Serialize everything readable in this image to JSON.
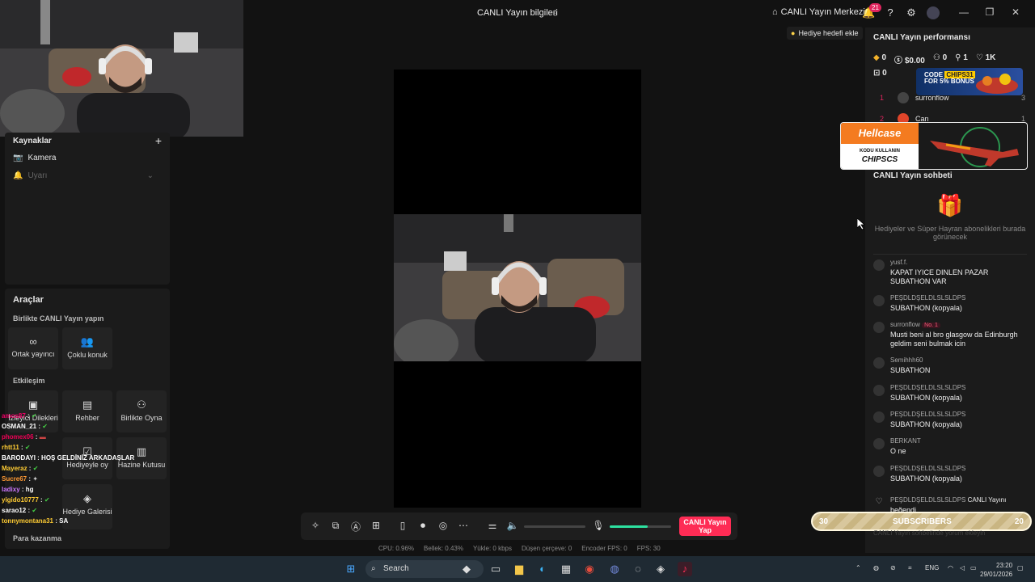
{
  "topbar": {
    "title": "CANLI Yayın bilgileri",
    "live_center": "CANLI Yayın Merkezi",
    "notification_count": "21"
  },
  "sources": {
    "heading": "Kaynaklar",
    "items": [
      "Kamera",
      "Uyarı"
    ]
  },
  "tools": {
    "heading": "Araçlar",
    "collab_heading": "Birlikte CANLI Yayın yapın",
    "collab": [
      "Ortak yayıncı",
      "Çoklu konuk"
    ],
    "interaction_heading": "Etkileşim",
    "interaction": [
      "İzleyici Dilekleri",
      "Rehber",
      "Birlikte Oyna",
      "Hediyeyle oy",
      "Hazine Kutusu",
      "Hediye Galerisi"
    ],
    "earn_heading": "Para kazanma"
  },
  "overlay_chat": [
    {
      "user": "amos87",
      "msg": ""
    },
    {
      "user": "OSMAN_21",
      "msg": ""
    },
    {
      "user": "phomex06",
      "msg": ""
    },
    {
      "user": "rhtt11",
      "msg": ""
    },
    {
      "user": "BARODAYI",
      "msg": "HOŞ GELDİNİZ ARKADAŞLAR"
    },
    {
      "user": "Mayeraz",
      "msg": ""
    },
    {
      "user": "Sucre67",
      "msg": ""
    },
    {
      "user": "ladixy",
      "msg": "hg"
    },
    {
      "user": "yigido10777",
      "msg": ""
    },
    {
      "user": "sarao12",
      "msg": ""
    },
    {
      "user": "tonnymontana31",
      "msg": "SA"
    }
  ],
  "controls": {
    "go_live": "CANLI Yayın Yap",
    "volume_level": 0,
    "mic_level": 0.62
  },
  "stats": {
    "cpu": "CPU: 0.96%",
    "memory": "Bellek: 0.43%",
    "upload": "Yükle: 0 kbps",
    "dropped": "Düşen çerçeve: 0",
    "encoder": "Encoder FPS: 0",
    "fps": "FPS: 30"
  },
  "goal_button": "Hediye hedefi ekle",
  "performance": {
    "title": "CANLI Yayın performansı",
    "diamonds": "0",
    "earnings": "$0.00",
    "viewers": "0",
    "followers": "1",
    "likes": "1K",
    "gifts": "0"
  },
  "ranking": [
    {
      "rank": "1",
      "user": "surronflow",
      "count": "3"
    },
    {
      "rank": "2",
      "user": "Can",
      "count": "1"
    }
  ],
  "live_chat": {
    "title": "CANLI Yayın sohbeti",
    "empty_gifts": "Hediyeler ve Süper Hayran abonelikleri burada görünecek",
    "messages": [
      {
        "user": "yusf.f.",
        "text": "KAPAT IYICE DINLEN PAZAR SUBATHON VAR"
      },
      {
        "user": "PEŞDLDŞELDLSLSLDPS",
        "text": "SUBATHON (kopyala)"
      },
      {
        "user": "surronflow",
        "badge": "No. 1",
        "text": "Musti beni al bro glasgow da Edinburgh geldim seni bulmak icin"
      },
      {
        "user": "Semihhh60",
        "text": "SUBATHON"
      },
      {
        "user": "PEŞDLDŞELDLSLSLDPS",
        "text": "SUBATHON (kopyala)"
      },
      {
        "user": "PEŞDLDŞELDLSLSLDPS",
        "text": "SUBATHON (kopyala)"
      },
      {
        "user": "BERKANT",
        "text": "O ne"
      },
      {
        "user": "PEŞDLDŞELDLSLSLDPS",
        "text": "SUBATHON (kopyala)"
      }
    ],
    "last_event_user": "PEŞDLDŞELDLSLSLDPS",
    "last_event_action": "CANLI Yayını",
    "last_event_action2": "beğendi",
    "input_placeholder": "CANLI Yayın sohbetinde yorum ekleyin"
  },
  "ads": {
    "chips_line1": "CODE",
    "chips_code": "CHIPS31",
    "chips_line2": "FOR 5% BONUS",
    "hellcase_brand": "Hellcase",
    "hellcase_line": "KODU KULLANIN",
    "hellcase_code": "CHIPSCS"
  },
  "subs_bar": {
    "left": "30",
    "label": "SUBSCRIBERS",
    "right": "20"
  },
  "taskbar": {
    "search": "Search",
    "lang": "ENG",
    "time": "23:20",
    "date": "29/01/2026"
  }
}
